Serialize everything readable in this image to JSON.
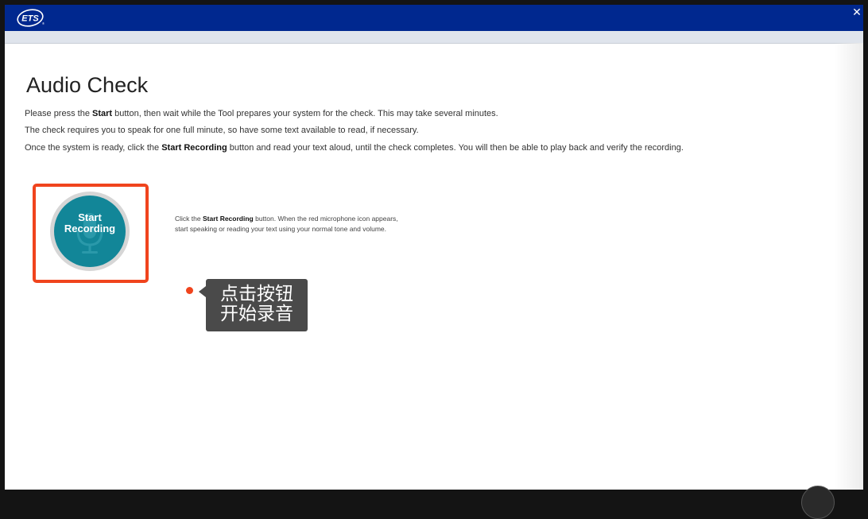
{
  "header": {
    "logo_text": "ETS",
    "logo_mark": "®",
    "close_icon": "close-x"
  },
  "page": {
    "title": "Audio Check",
    "instructions": [
      {
        "before": "Please press the ",
        "bold": "Start",
        "after": " button, then wait while the Tool prepares your system for the check. This may take several minutes."
      },
      {
        "before": "The check requires you to speak for one full minute, so have some text available to read, if necessary.",
        "bold": "",
        "after": ""
      },
      {
        "before": "Once the system is ready, click the ",
        "bold": "Start Recording",
        "after": " button and read your text aloud, until the check completes. You will then be able to play back and verify the recording."
      }
    ]
  },
  "recorder": {
    "button_line1": "Start",
    "button_line2": "Recording",
    "icon": "microphone-icon",
    "highlight_color": "#f0441d",
    "button_color": "#128698"
  },
  "help": {
    "before": "Click the ",
    "bold": "Start Recording",
    "after": " button. When the red microphone icon appears, start speaking or reading your text using your normal tone and volume."
  },
  "callout": {
    "line1": "点击按钮",
    "line2": "开始录音"
  },
  "colors": {
    "titlebar": "#00288f",
    "subbar": "#dfe4ec"
  }
}
